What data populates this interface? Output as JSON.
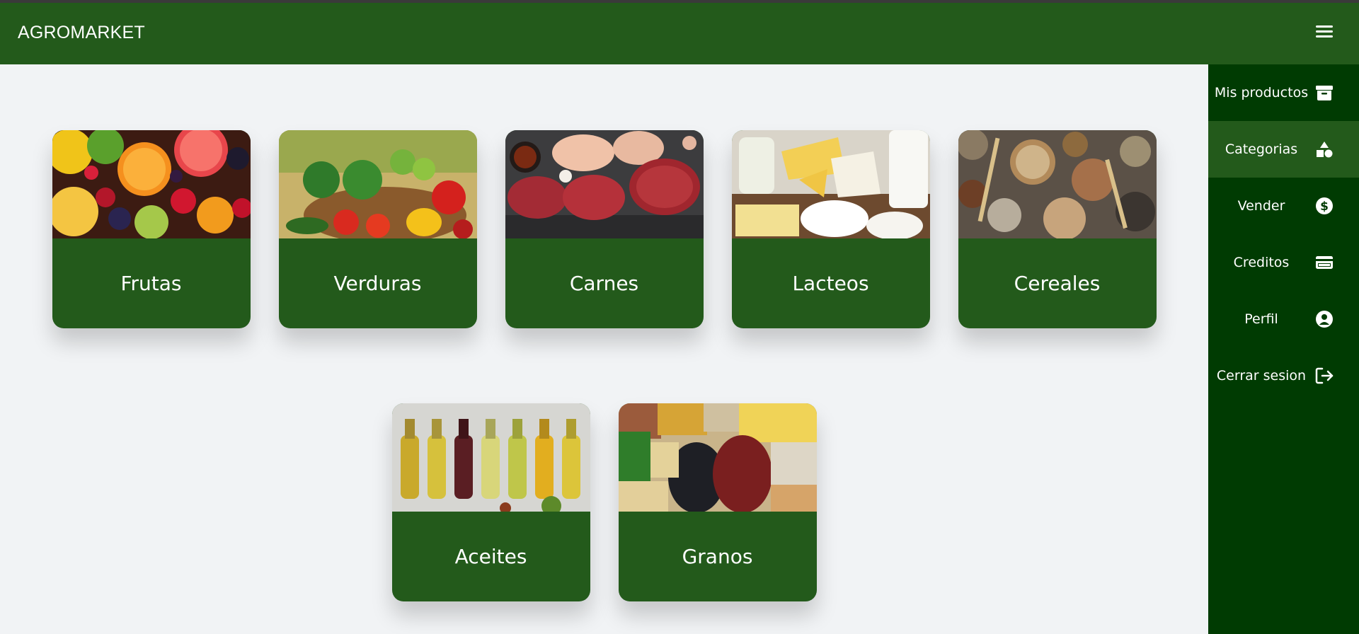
{
  "app": {
    "brand": "AGROMARKET"
  },
  "categories": [
    {
      "label": "Frutas",
      "image": "fruits"
    },
    {
      "label": "Verduras",
      "image": "vegetables"
    },
    {
      "label": "Carnes",
      "image": "meats"
    },
    {
      "label": "Lacteos",
      "image": "dairy"
    },
    {
      "label": "Cereales",
      "image": "cereals"
    },
    {
      "label": "Aceites",
      "image": "oils"
    },
    {
      "label": "Granos",
      "image": "grains"
    }
  ],
  "sidebar": {
    "items": [
      {
        "label": "Mis productos",
        "icon": "archive-icon"
      },
      {
        "label": "Categorias",
        "icon": "shapes-icon",
        "active": true
      },
      {
        "label": "Vender",
        "icon": "dollar-icon"
      },
      {
        "label": "Creditos",
        "icon": "credit-card-icon"
      },
      {
        "label": "Perfil",
        "icon": "user-circle-icon"
      },
      {
        "label": "Cerrar sesion",
        "icon": "logout-icon"
      }
    ]
  },
  "colors": {
    "primary": "#235a1b",
    "sidebar": "#003b02",
    "background": "#f1f3f5"
  }
}
